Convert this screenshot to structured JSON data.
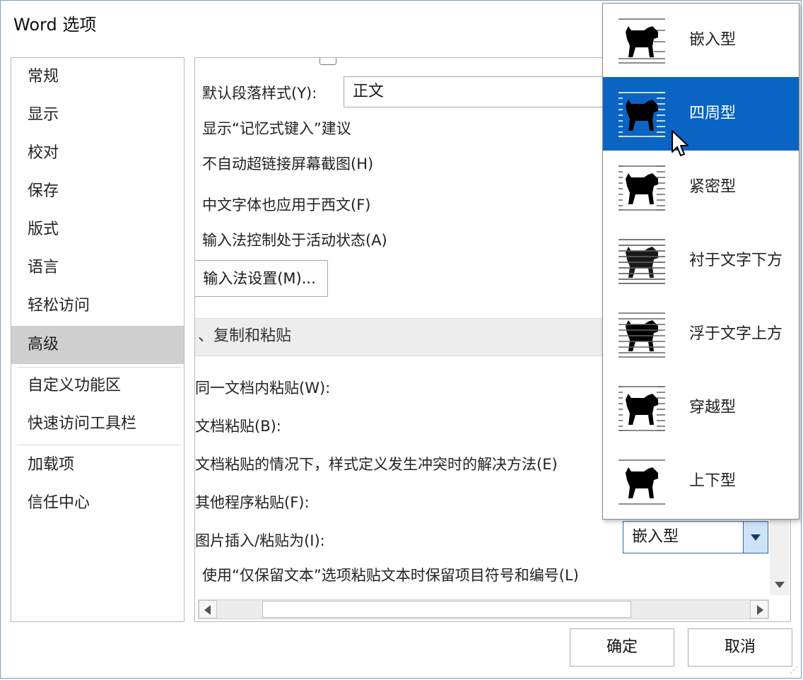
{
  "window": {
    "title": "Word 选项"
  },
  "nav": {
    "items": [
      {
        "label": "常规"
      },
      {
        "label": "显示"
      },
      {
        "label": "校对"
      },
      {
        "label": "保存"
      },
      {
        "label": "版式"
      },
      {
        "label": "语言"
      },
      {
        "label": "轻松访问"
      },
      {
        "label": "高级",
        "selected": true
      },
      {
        "label": "自定义功能区"
      },
      {
        "label": "快速访问工具栏"
      },
      {
        "label": "加载项"
      },
      {
        "label": "信任中心"
      }
    ]
  },
  "main": {
    "default_style_label": "默认段落样式(Y):",
    "default_style_value": "正文",
    "show_autocomplete": "显示“记忆式键入”建议",
    "no_autolink_screenshot": "不自动超链接屏幕截图(H)",
    "chinese_font_western": "中文字体也应用于西文(F)",
    "ime_control_active": "输入法控制处于活动状态(A)",
    "ime_settings_button": "输入法设置(M)...",
    "section_cut_copy_paste": "、复制和粘贴",
    "paste_within_doc": "同一文档内粘贴(W):",
    "paste_between_docs": "文档粘贴(B):",
    "paste_conflict": "文档粘贴的情况下，样式定义发生冲突时的解决方法(E)",
    "paste_other_programs": "其他程序粘贴(F):",
    "picture_insert_label": "图片插入/粘贴为(I):",
    "picture_insert_value": "嵌入型",
    "keep_bullets": "使用“仅保留文本”选项粘贴文本时保留项目符号和编号(L)"
  },
  "dropdown": {
    "options": [
      {
        "label": "嵌入型",
        "icon": "inline-wrap-icon"
      },
      {
        "label": "四周型",
        "icon": "square-wrap-icon",
        "selected": true
      },
      {
        "label": "紧密型",
        "icon": "tight-wrap-icon"
      },
      {
        "label": "衬于文字下方",
        "icon": "behind-text-icon"
      },
      {
        "label": "浮于文字上方",
        "icon": "in-front-of-text-icon"
      },
      {
        "label": "穿越型",
        "icon": "through-wrap-icon"
      },
      {
        "label": "上下型",
        "icon": "top-bottom-wrap-icon"
      }
    ]
  },
  "buttons": {
    "ok": "确定",
    "cancel": "取消"
  },
  "colors": {
    "selection_blue": "#0a64c4",
    "nav_selected": "#cfcfcf",
    "border": "#b9b9b9"
  }
}
